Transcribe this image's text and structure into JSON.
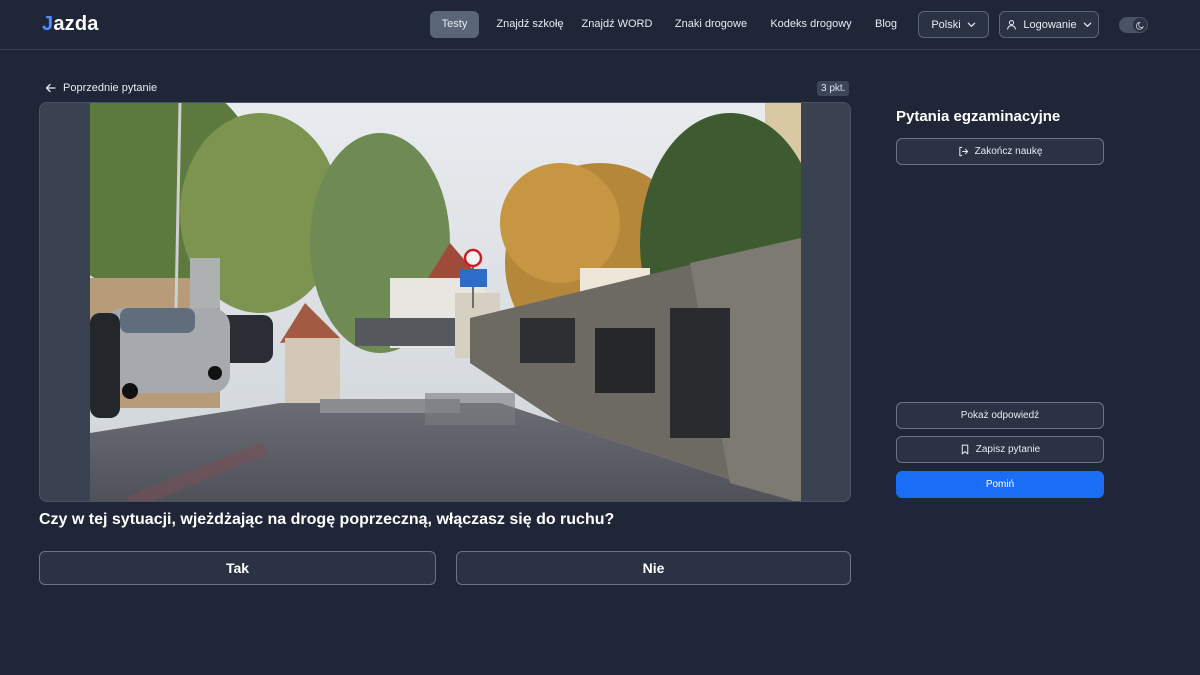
{
  "header": {
    "logo_text": "azda",
    "nav": [
      {
        "label": "Testy",
        "active": true
      },
      {
        "label": "Znajdź szkołę",
        "active": false
      },
      {
        "label": "Znajdź WORD",
        "active": false
      },
      {
        "label": "Znaki drogowe",
        "active": false
      },
      {
        "label": "Kodeks drogowy",
        "active": false
      },
      {
        "label": "Blog",
        "active": false
      }
    ],
    "language": "Polski",
    "login": "Logowanie",
    "theme_icon": "moon-icon"
  },
  "question_view": {
    "back_label": "Poprzednie pytanie",
    "points": "3 pkt.",
    "question_text": "Czy w tej sytuacji, wjeżdżając na drogę poprzeczną, włączasz się do ruchu?",
    "answers": [
      {
        "label": "Tak"
      },
      {
        "label": "Nie"
      }
    ]
  },
  "sidebar": {
    "title": "Pytania egzaminacyjne",
    "end_label": "Zakończ naukę",
    "show_answer_label": "Pokaż odpowiedź",
    "save_label": "Zapisz pytanie",
    "skip_label": "Pomiń"
  },
  "colors": {
    "background": "#1f2637",
    "primary": "#1a6ef5",
    "nav_active": "#5b6578"
  }
}
